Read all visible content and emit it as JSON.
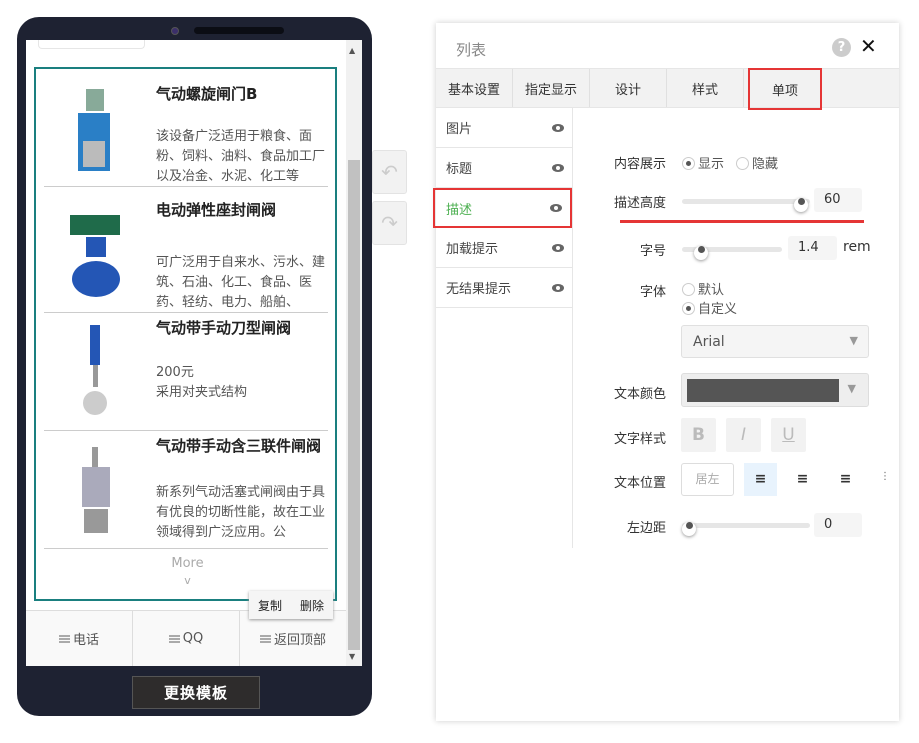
{
  "phone": {
    "products": [
      {
        "title": "气动螺旋闸门B",
        "desc": "该设备广泛适用于粮食、面粉、饲料、油料、食品加工厂以及冶金、水泥、化工等"
      },
      {
        "title": "电动弹性座封闸阀",
        "desc": "可广泛用于自来水、污水、建筑、石油、化工、食品、医药、轻纺、电力、船舶、"
      },
      {
        "title": "气动带手动刀型闸阀",
        "price": "200元",
        "desc": "采用对夹式结构"
      },
      {
        "title": "气动带手动含三联件闸阀",
        "desc": "新系列气动活塞式闸阀由于具有优良的切断性能，故在工业领域得到广泛应用。公"
      }
    ],
    "more": "More",
    "more_chevron": "v",
    "copy": "复制",
    "delete": "删除",
    "footer": [
      "电话",
      "QQ",
      "返回顶部"
    ],
    "swap_template": "更换模板",
    "undo_icon": "↶",
    "redo_icon": "↷"
  },
  "panel": {
    "title": "列表",
    "help": "?",
    "close": "✕",
    "tabs": [
      "基本设置",
      "指定显示",
      "设计",
      "样式",
      "单项"
    ],
    "side": [
      "图片",
      "标题",
      "描述",
      "加载提示",
      "无结果提示"
    ],
    "form": {
      "content_display": "内容展示",
      "show": "显示",
      "hide": "隐藏",
      "desc_height": "描述高度",
      "desc_height_value": "60",
      "desc_height_fraction": 1.0,
      "font_size": "字号",
      "font_size_value": "1.4",
      "font_size_unit": "rem",
      "font_size_fraction": 0.15,
      "font": "字体",
      "default": "默认",
      "custom": "自定义",
      "font_select": "Arial",
      "text_color": "文本颜色",
      "text_color_value": "#555555",
      "text_style": "文字样式",
      "bold": "B",
      "italic": "I",
      "underline": "U",
      "text_position": "文本位置",
      "align_left_label": "居左",
      "left_margin": "左边距",
      "left_margin_value": "0",
      "left_margin_fraction": 0
    }
  },
  "colors": {
    "accent": "#4caf50",
    "highlight": "#e53535",
    "list_border": "#1a7f7f"
  }
}
